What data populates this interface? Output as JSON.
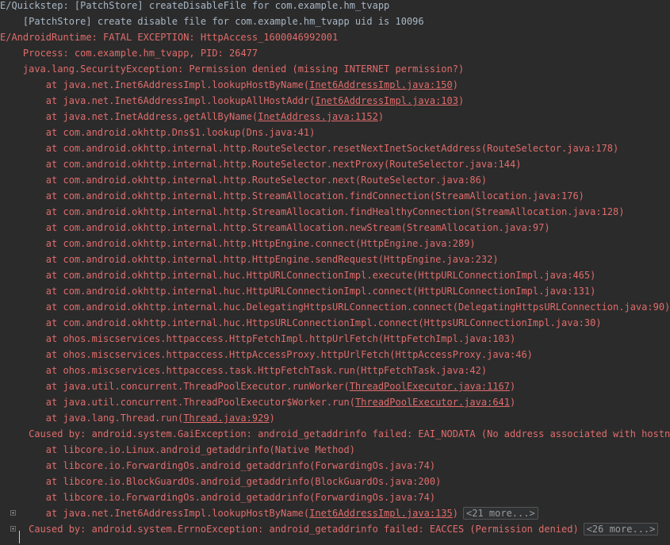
{
  "console": {
    "lines": [
      {
        "indent": "",
        "pre": "E/Quickstep: [PatchStore] createDisableFile for com.example.hm_tvapp",
        "link": "",
        "post": "",
        "more": "",
        "cls": "gray"
      },
      {
        "indent": "    ",
        "pre": "[PatchStore] create disable file for com.example.hm_tvapp uid is 10096",
        "link": "",
        "post": "",
        "more": "",
        "cls": "gray"
      },
      {
        "indent": "",
        "pre": "E/AndroidRuntime: FATAL EXCEPTION: HttpAccess_1600046992001",
        "link": "",
        "post": "",
        "more": "",
        "cls": "red"
      },
      {
        "indent": "    ",
        "pre": "Process: com.example.hm_tvapp, PID: 26477",
        "link": "",
        "post": "",
        "more": "",
        "cls": "red"
      },
      {
        "indent": "    ",
        "pre": "java.lang.SecurityException: Permission denied (missing INTERNET permission?)",
        "link": "",
        "post": "",
        "more": "",
        "cls": "red"
      },
      {
        "indent": "        ",
        "pre": "at java.net.Inet6AddressImpl.lookupHostByName(",
        "link": "Inet6AddressImpl.java:150",
        "post": ")",
        "more": "",
        "cls": "red"
      },
      {
        "indent": "        ",
        "pre": "at java.net.Inet6AddressImpl.lookupAllHostAddr(",
        "link": "Inet6AddressImpl.java:103",
        "post": ")",
        "more": "",
        "cls": "red"
      },
      {
        "indent": "        ",
        "pre": "at java.net.InetAddress.getAllByName(",
        "link": "InetAddress.java:1152",
        "post": ")",
        "more": "",
        "cls": "red"
      },
      {
        "indent": "        ",
        "pre": "at com.android.okhttp.Dns$1.lookup(Dns.java:41)",
        "link": "",
        "post": "",
        "more": "",
        "cls": "red"
      },
      {
        "indent": "        ",
        "pre": "at com.android.okhttp.internal.http.RouteSelector.resetNextInetSocketAddress(RouteSelector.java:178)",
        "link": "",
        "post": "",
        "more": "",
        "cls": "red"
      },
      {
        "indent": "        ",
        "pre": "at com.android.okhttp.internal.http.RouteSelector.nextProxy(RouteSelector.java:144)",
        "link": "",
        "post": "",
        "more": "",
        "cls": "red"
      },
      {
        "indent": "        ",
        "pre": "at com.android.okhttp.internal.http.RouteSelector.next(RouteSelector.java:86)",
        "link": "",
        "post": "",
        "more": "",
        "cls": "red"
      },
      {
        "indent": "        ",
        "pre": "at com.android.okhttp.internal.http.StreamAllocation.findConnection(StreamAllocation.java:176)",
        "link": "",
        "post": "",
        "more": "",
        "cls": "red"
      },
      {
        "indent": "        ",
        "pre": "at com.android.okhttp.internal.http.StreamAllocation.findHealthyConnection(StreamAllocation.java:128)",
        "link": "",
        "post": "",
        "more": "",
        "cls": "red"
      },
      {
        "indent": "        ",
        "pre": "at com.android.okhttp.internal.http.StreamAllocation.newStream(StreamAllocation.java:97)",
        "link": "",
        "post": "",
        "more": "",
        "cls": "red"
      },
      {
        "indent": "        ",
        "pre": "at com.android.okhttp.internal.http.HttpEngine.connect(HttpEngine.java:289)",
        "link": "",
        "post": "",
        "more": "",
        "cls": "red"
      },
      {
        "indent": "        ",
        "pre": "at com.android.okhttp.internal.http.HttpEngine.sendRequest(HttpEngine.java:232)",
        "link": "",
        "post": "",
        "more": "",
        "cls": "red"
      },
      {
        "indent": "        ",
        "pre": "at com.android.okhttp.internal.huc.HttpURLConnectionImpl.execute(HttpURLConnectionImpl.java:465)",
        "link": "",
        "post": "",
        "more": "",
        "cls": "red"
      },
      {
        "indent": "        ",
        "pre": "at com.android.okhttp.internal.huc.HttpURLConnectionImpl.connect(HttpURLConnectionImpl.java:131)",
        "link": "",
        "post": "",
        "more": "",
        "cls": "red"
      },
      {
        "indent": "        ",
        "pre": "at com.android.okhttp.internal.huc.DelegatingHttpsURLConnection.connect(DelegatingHttpsURLConnection.java:90)",
        "link": "",
        "post": "",
        "more": "",
        "cls": "red"
      },
      {
        "indent": "        ",
        "pre": "at com.android.okhttp.internal.huc.HttpsURLConnectionImpl.connect(HttpsURLConnectionImpl.java:30)",
        "link": "",
        "post": "",
        "more": "",
        "cls": "red"
      },
      {
        "indent": "        ",
        "pre": "at ohos.miscservices.httpaccess.HttpFetchImpl.httpUrlFetch(HttpFetchImpl.java:103)",
        "link": "",
        "post": "",
        "more": "",
        "cls": "red"
      },
      {
        "indent": "        ",
        "pre": "at ohos.miscservices.httpaccess.HttpAccessProxy.httpUrlFetch(HttpAccessProxy.java:46)",
        "link": "",
        "post": "",
        "more": "",
        "cls": "red"
      },
      {
        "indent": "        ",
        "pre": "at ohos.miscservices.httpaccess.task.HttpFetchTask.run(HttpFetchTask.java:42)",
        "link": "",
        "post": "",
        "more": "",
        "cls": "red"
      },
      {
        "indent": "        ",
        "pre": "at java.util.concurrent.ThreadPoolExecutor.runWorker(",
        "link": "ThreadPoolExecutor.java:1167",
        "post": ")",
        "more": "",
        "cls": "red"
      },
      {
        "indent": "        ",
        "pre": "at java.util.concurrent.ThreadPoolExecutor$Worker.run(",
        "link": "ThreadPoolExecutor.java:641",
        "post": ")",
        "more": "",
        "cls": "red"
      },
      {
        "indent": "        ",
        "pre": "at java.lang.Thread.run(",
        "link": "Thread.java:929",
        "post": ")",
        "more": "",
        "cls": "red"
      },
      {
        "indent": "     ",
        "pre": "Caused by: android.system.GaiException: android_getaddrinfo failed: EAI_NODATA (No address associated with hostname)",
        "link": "",
        "post": "",
        "more": "",
        "cls": "red"
      },
      {
        "indent": "        ",
        "pre": "at libcore.io.Linux.android_getaddrinfo(Native Method)",
        "link": "",
        "post": "",
        "more": "",
        "cls": "red"
      },
      {
        "indent": "        ",
        "pre": "at libcore.io.ForwardingOs.android_getaddrinfo(ForwardingOs.java:74)",
        "link": "",
        "post": "",
        "more": "",
        "cls": "red"
      },
      {
        "indent": "        ",
        "pre": "at libcore.io.BlockGuardOs.android_getaddrinfo(BlockGuardOs.java:200)",
        "link": "",
        "post": "",
        "more": "",
        "cls": "red"
      },
      {
        "indent": "        ",
        "pre": "at libcore.io.ForwardingOs.android_getaddrinfo(ForwardingOs.java:74)",
        "link": "",
        "post": "",
        "more": "",
        "cls": "red"
      },
      {
        "indent": "        ",
        "pre": "at java.net.Inet6AddressImpl.lookupHostByName(",
        "link": "Inet6AddressImpl.java:135",
        "post": ")",
        "more": "<21 more...>",
        "cls": "red",
        "fold": true
      },
      {
        "indent": "     ",
        "pre": "Caused by: android.system.ErrnoException: android_getaddrinfo failed: EACCES (Permission denied)",
        "link": "",
        "post": "",
        "more": "<26 more...>",
        "cls": "red",
        "fold": true
      }
    ]
  }
}
